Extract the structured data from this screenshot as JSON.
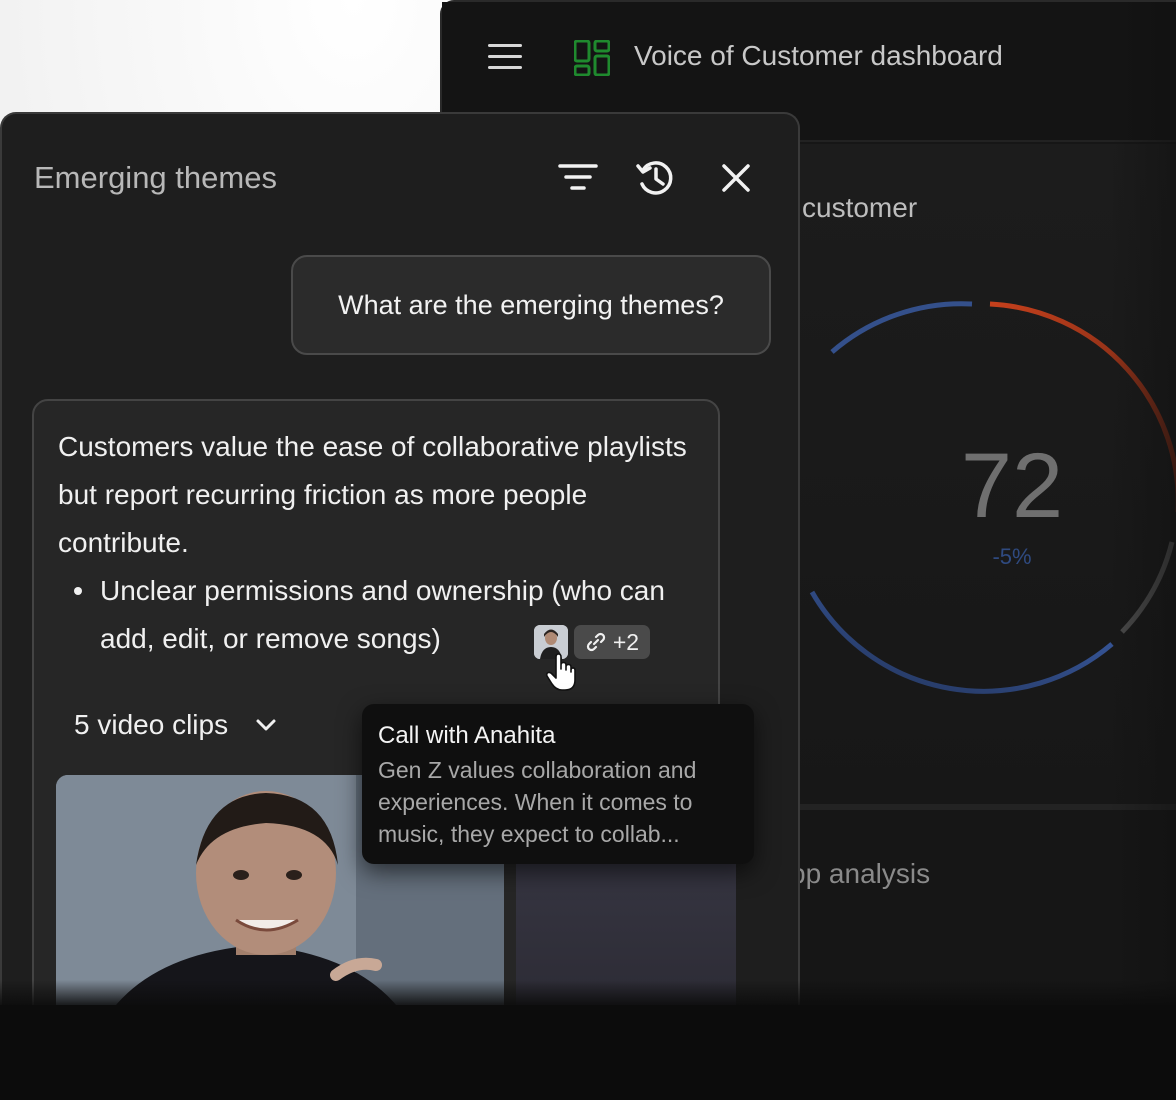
{
  "dashboard": {
    "title": "Voice of Customer dashboard",
    "card_title": "customer",
    "score": "72",
    "score_change": "-5%",
    "card2_title": "pp analysis",
    "colors": {
      "accent_red": "#c5401c",
      "accent_blue": "#3b5ea8",
      "logo_green": "#1f8a2e"
    }
  },
  "panel": {
    "title": "Emerging themes",
    "user_message": "What are the emerging themes?",
    "answer_intro": "Customers value the ease of collaborative playlists but report recurring friction as more people contribute.",
    "bullet": "Unclear permissions and ownership (who can add, edit, or remove songs)",
    "source_count": "+2",
    "clips_label": "5 video clips"
  },
  "tooltip": {
    "title": "Call with Anahita",
    "body": "Gen Z values collaboration and experiences. When it comes to music, they expect to collab..."
  }
}
